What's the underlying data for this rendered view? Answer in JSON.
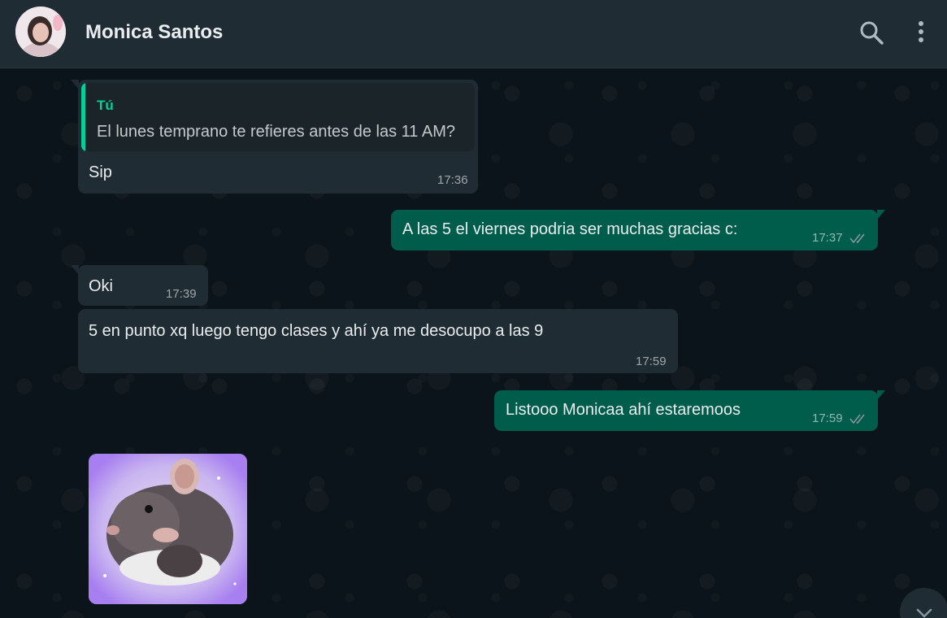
{
  "header": {
    "contact_name": "Monica Santos",
    "avatar_icon": "contact-avatar",
    "search_icon": "search-icon",
    "menu_icon": "more-vertical-icon"
  },
  "messages": [
    {
      "direction": "incoming",
      "quote": {
        "author": "Tú",
        "text": "El lunes temprano te refieres antes de las 11 AM?"
      },
      "text": "Sip",
      "time": "17:36"
    },
    {
      "direction": "outgoing",
      "text": "A las 5 el viernes podria ser muchas gracias c:",
      "time": "17:37",
      "status": "read"
    },
    {
      "direction": "incoming",
      "text": "Oki",
      "time": "17:39"
    },
    {
      "direction": "incoming",
      "text": "5 en punto xq luego tengo clases y ahí ya me desocupo a las 9",
      "time": "17:59"
    },
    {
      "direction": "outgoing",
      "text": "Listooo Monicaa ahí estaremoos",
      "time": "17:59",
      "status": "read"
    },
    {
      "direction": "incoming",
      "type": "sticker",
      "sticker_icon": "rat-sticker"
    }
  ],
  "colors": {
    "header_bg": "#202c33",
    "chat_bg": "#0b141a",
    "incoming_bubble": "#202c33",
    "outgoing_bubble": "#005c4b",
    "quote_accent": "#06cf9c",
    "read_ticks": "#8696a0"
  },
  "scroll_down_icon": "chevron-down-icon"
}
